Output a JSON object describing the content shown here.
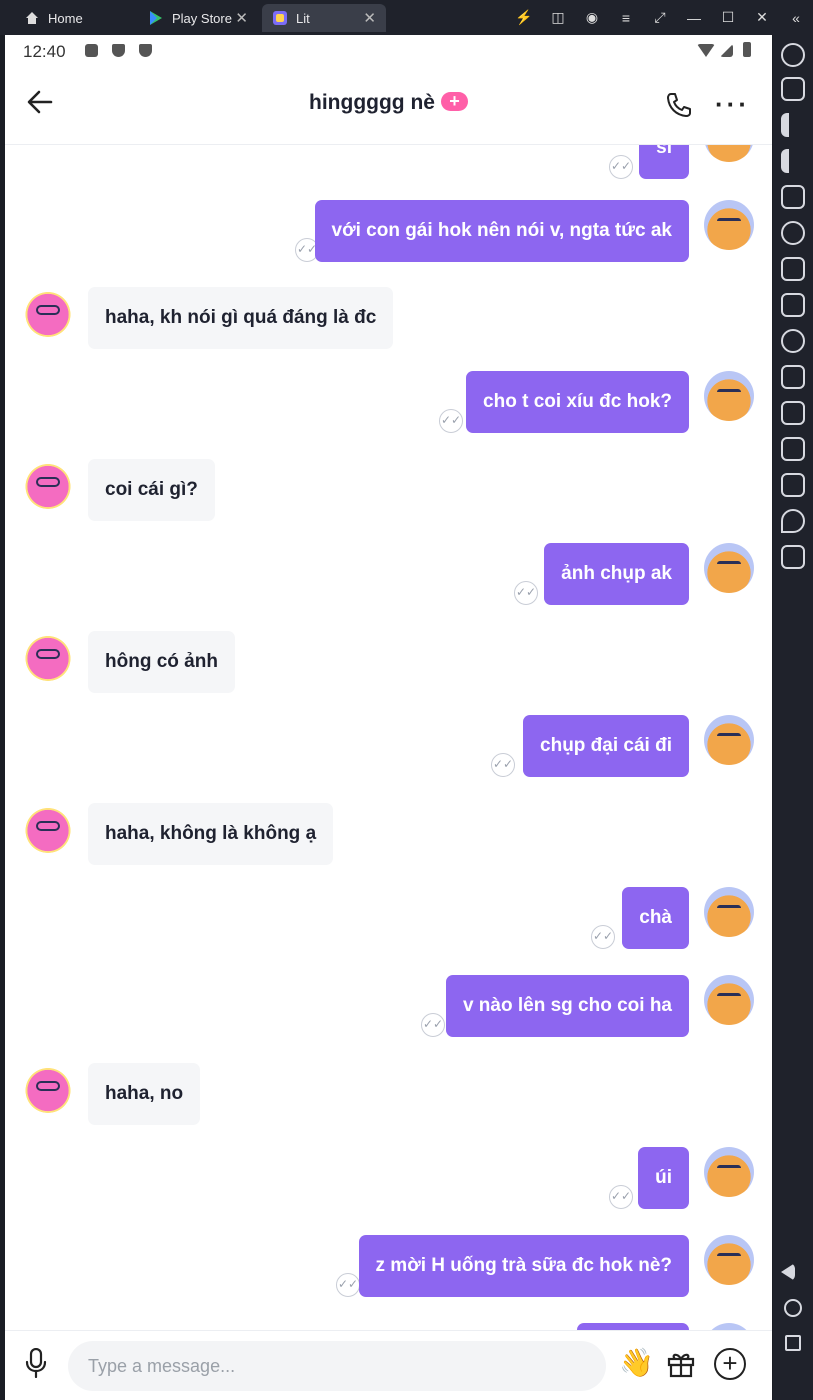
{
  "browser": {
    "tabs": [
      {
        "label": "Home",
        "icon": "home-icon"
      },
      {
        "label": "Play Store",
        "icon": "play-store-icon"
      },
      {
        "label": "Lit",
        "icon": "lit-app-icon"
      }
    ],
    "tab_close": "✕"
  },
  "status_bar": {
    "time": "12:40"
  },
  "header": {
    "title": "hinggggg nè",
    "badge": "+",
    "back_icon": "arrow-left-icon",
    "call_icon": "phone-icon",
    "more_icon": "more-dots-icon"
  },
  "messages": [
    {
      "dir": "out",
      "text": "sĩ"
    },
    {
      "dir": "out",
      "text": "với con gái hok nên nói v, ngta tức ak"
    },
    {
      "dir": "in",
      "text": "haha, kh nói gì quá đáng là đc"
    },
    {
      "dir": "out",
      "text": "cho t coi xíu đc hok?"
    },
    {
      "dir": "in",
      "text": "coi cái gì?"
    },
    {
      "dir": "out",
      "text": "ảnh chụp ak"
    },
    {
      "dir": "in",
      "text": "hông có ảnh"
    },
    {
      "dir": "out",
      "text": "chụp đại cái đi"
    },
    {
      "dir": "in",
      "text": "haha, không là không ạ"
    },
    {
      "dir": "out",
      "text": "chà"
    },
    {
      "dir": "out",
      "text": "v nào lên sg cho coi ha"
    },
    {
      "dir": "in",
      "text": "haha, no"
    },
    {
      "dir": "out",
      "text": "úi"
    },
    {
      "dir": "out",
      "text": "z mời H uống trà sữa đc hok nè?"
    }
  ],
  "composer": {
    "placeholder": "Type a message...",
    "wave": "👋",
    "plus": "+"
  },
  "colors": {
    "accent": "#8d66f0",
    "incoming_bubble": "#f5f6f8",
    "badge": "#ff5fa8"
  }
}
